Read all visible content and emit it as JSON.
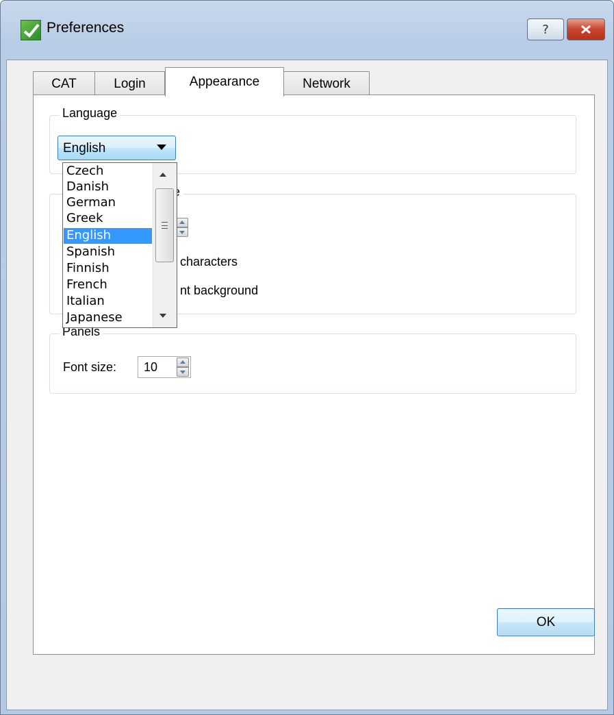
{
  "window": {
    "title": "Preferences",
    "help_label": "?",
    "close_label": "✕"
  },
  "tabs": [
    {
      "label": "CAT"
    },
    {
      "label": "Login"
    },
    {
      "label": "Appearance"
    },
    {
      "label": "Network"
    }
  ],
  "active_tab": "Appearance",
  "language_group": {
    "legend": "Language",
    "selected": "English",
    "options": [
      "Czech",
      "Danish",
      "German",
      "Greek",
      "English",
      "Spanish",
      "Finnish",
      "French",
      "Italian",
      "Japanese"
    ]
  },
  "editor_group": {
    "legend_partial": "e",
    "text_characters": "characters",
    "text_background": "nt background"
  },
  "panels_group": {
    "legend": "Panels",
    "font_size_label": "Font size:",
    "font_size_value": "10"
  },
  "buttons": {
    "ok": "OK"
  },
  "icons": {
    "app": "app-logo-icon",
    "scroll_up": "scroll-up-icon",
    "scroll_down": "scroll-down-icon"
  }
}
